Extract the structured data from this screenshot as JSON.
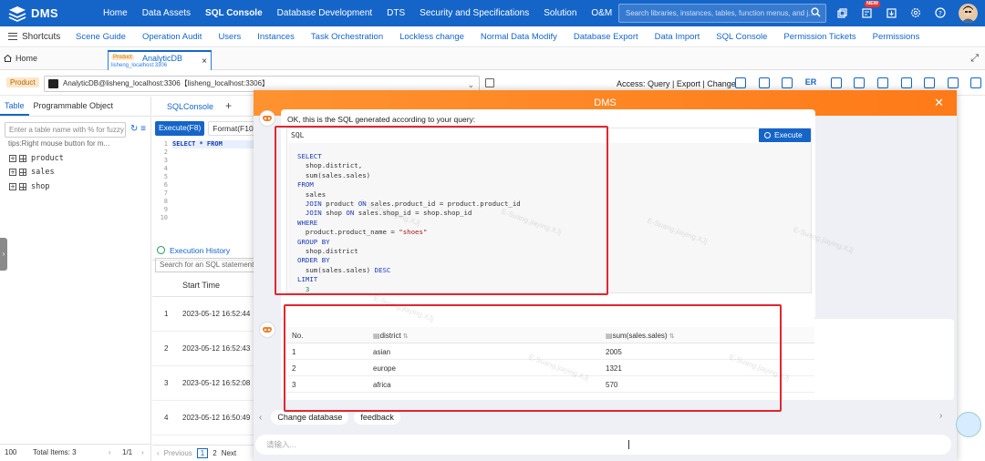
{
  "app": {
    "name": "DMS",
    "nav": [
      "Home",
      "Data Assets",
      "SQL Console",
      "Database Development",
      "DTS",
      "Security and Specifications",
      "Solution",
      "O&M"
    ],
    "nav_active": 2,
    "search_placeholder": "Search libraries, instances, tables, function menus, and j...",
    "new_badge": "NEW"
  },
  "subnav": {
    "shortcuts": "Shortcuts",
    "items": [
      "Scene Guide",
      "Operation Audit",
      "Users",
      "Instances",
      "Task Orchestration",
      "Lockless change",
      "Normal Data Modify",
      "Database Export",
      "Data Import",
      "SQL Console",
      "Permission Tickets",
      "Permissions"
    ]
  },
  "tabs": {
    "home": "Home",
    "active_badge": "Product",
    "active_name": "AnalyticDB",
    "active_sub": "lisheng_localhost:3306",
    "close": "×"
  },
  "dbbar": {
    "env": "Product",
    "db": "AnalyticDB@lisheng_localhost:3306【lisheng_localhost:3306】",
    "access": "Access:  Query | Export | Change",
    "er": "ER"
  },
  "left": {
    "tabs": [
      "Table",
      "Programmable Object"
    ],
    "search_placeholder": "Enter a table name with % for fuzzy m",
    "tip": "tips:Right mouse button for m...",
    "tables": [
      "product",
      "sales",
      "shop"
    ],
    "footer_size": "100",
    "footer_total": "Total Items: 3",
    "footer_page": "1/1"
  },
  "middle": {
    "tab": "SQLConsole",
    "execute": "Execute(F8)",
    "format": "Format(F10)",
    "line_numbers": "1\n2\n3\n4\n5\n6\n7\n8\n9\n10",
    "code": "SELECT * FROM",
    "history_title": "Execution History",
    "history_search": "Search for an SQL statement",
    "start_time": "Start Time",
    "history": [
      {
        "n": "1",
        "d": "2023-05-12 16:52:44"
      },
      {
        "n": "2",
        "d": "2023-05-12 16:52:43"
      },
      {
        "n": "3",
        "d": "2023-05-12 16:52:08"
      },
      {
        "n": "4",
        "d": "2023-05-12 16:50:49"
      }
    ],
    "pager": {
      "prev": "Previous",
      "p1": "1",
      "p2": "2",
      "next": "Next"
    }
  },
  "modal": {
    "title": "DMS",
    "intro": "OK, this is the SQL generated according to your query:",
    "sql_label": "SQL",
    "execute": "Execute",
    "results": {
      "headers": [
        "No.",
        "district",
        "sum(sales.sales)"
      ],
      "rows": [
        [
          "1",
          "asian",
          "2005"
        ],
        [
          "2",
          "europe",
          "1321"
        ],
        [
          "3",
          "africa",
          "570"
        ]
      ]
    },
    "chips": [
      "Change database",
      "feedback"
    ],
    "input_placeholder": "请输入..."
  },
  "watermark": "E-Suang.jiaying.XJj",
  "colors": {
    "primary": "#1565c9",
    "modal_header": "#ff8a24",
    "highlight": "#e3262e"
  }
}
